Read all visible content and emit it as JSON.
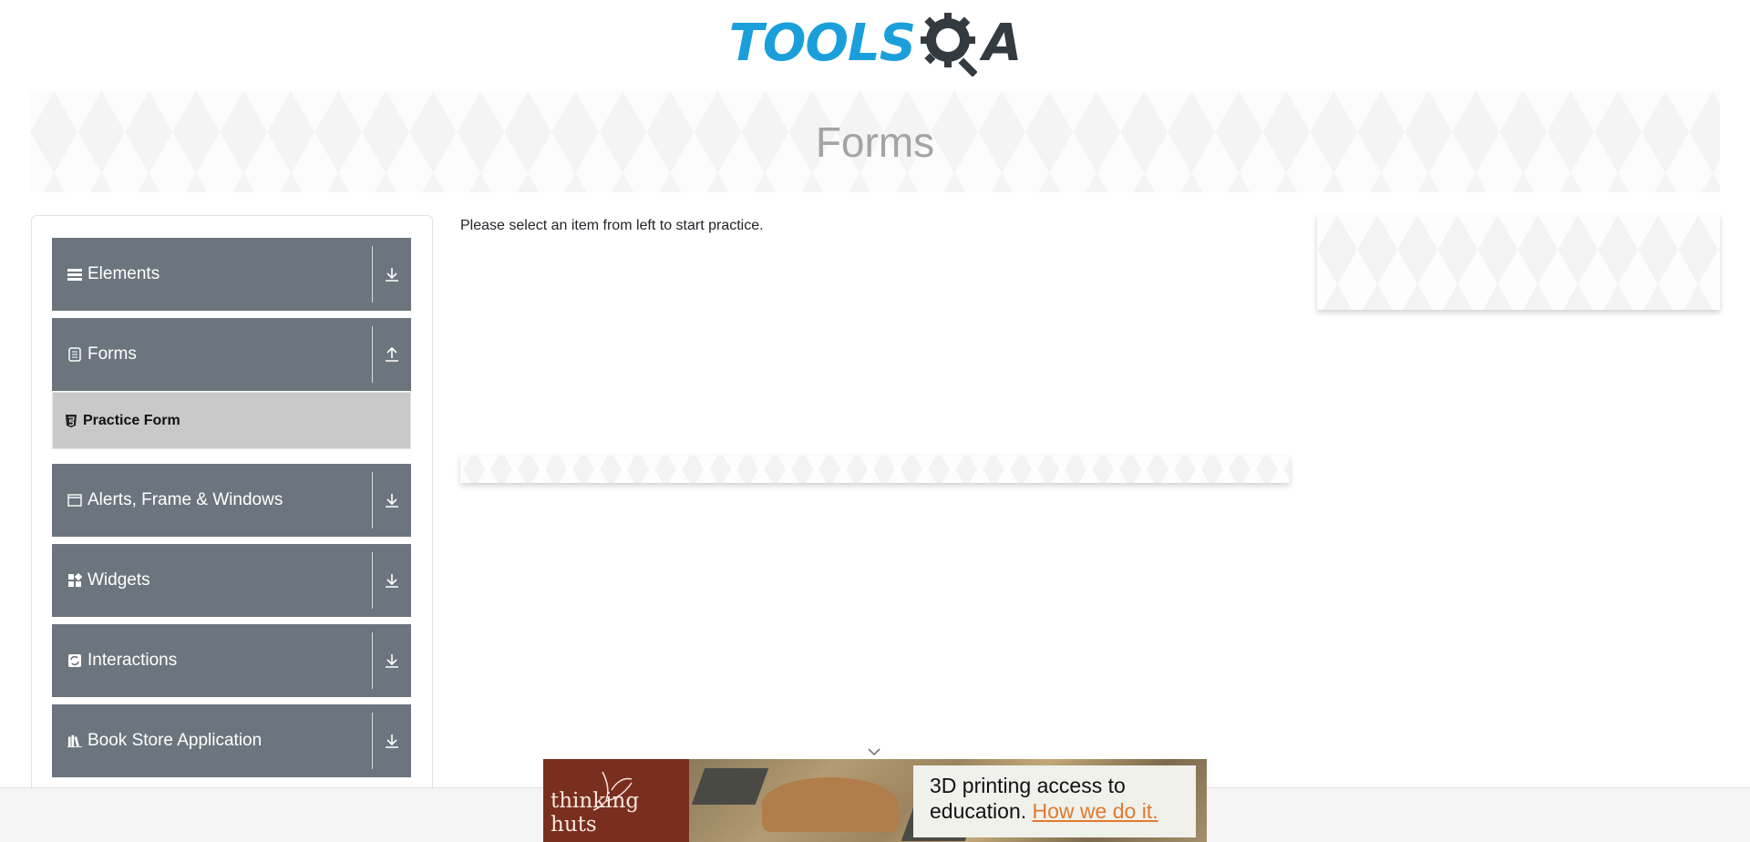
{
  "header": {
    "logo_part1": "TOOLS",
    "logo_part2": "QA"
  },
  "banner": {
    "title": "Forms"
  },
  "sidebar": {
    "groups": [
      {
        "label": "Elements",
        "icon": "list-icon",
        "toggle": "download-arrow-icon"
      },
      {
        "label": "Forms",
        "icon": "form-icon",
        "toggle": "upload-arrow-icon"
      },
      {
        "label": "Alerts, Frame & Windows",
        "icon": "window-icon",
        "toggle": "download-arrow-icon"
      },
      {
        "label": "Widgets",
        "icon": "widgets-icon",
        "toggle": "download-arrow-icon"
      },
      {
        "label": "Interactions",
        "icon": "interactions-icon",
        "toggle": "download-arrow-icon"
      },
      {
        "label": "Book Store Application",
        "icon": "books-icon",
        "toggle": "download-arrow-icon"
      }
    ],
    "forms_items": [
      {
        "label": "Practice Form",
        "icon": "html5-icon"
      }
    ]
  },
  "main": {
    "message": "Please select an item from left to start practice."
  },
  "ad": {
    "brand": "thinking huts",
    "message_line1": "3D printing access to",
    "message_line2": "education.",
    "cta": "How we do it."
  },
  "colors": {
    "group_bg": "#6c757d",
    "subitem_bg": "#c9c9c9",
    "logo_blue": "#1a9fdb",
    "logo_dark": "#333a40",
    "ad_brand_bg": "#7a2e1e",
    "ad_cta": "#e07a2c"
  }
}
